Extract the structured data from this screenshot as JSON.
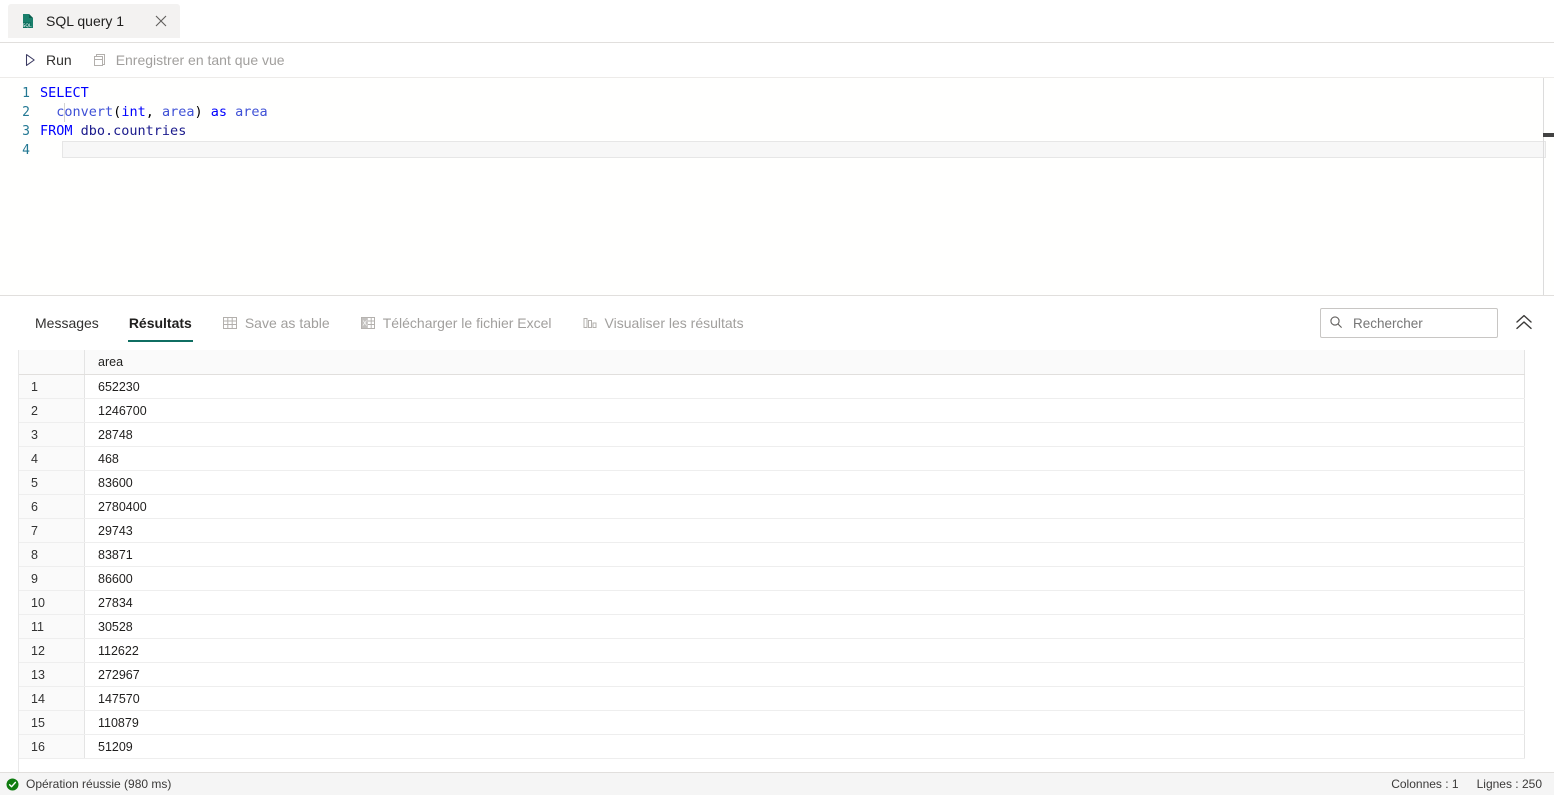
{
  "tab": {
    "icon": "sql-file-icon",
    "label": "SQL query 1",
    "close_icon": "close-icon"
  },
  "toolbar": {
    "run": {
      "label": "Run",
      "icon": "play-icon"
    },
    "save_as_view": {
      "label": "Enregistrer en tant que vue",
      "icon": "save-view-icon",
      "disabled": true
    }
  },
  "editor": {
    "lines": [
      {
        "number": "1",
        "tokens": [
          {
            "t": "SELECT",
            "c": "kw"
          }
        ]
      },
      {
        "number": "2",
        "tokens": [
          {
            "t": "  ",
            "c": "pl"
          },
          {
            "t": "convert",
            "c": "fn"
          },
          {
            "t": "(",
            "c": "pl"
          },
          {
            "t": "int",
            "c": "kw"
          },
          {
            "t": ", ",
            "c": "pl"
          },
          {
            "t": "area",
            "c": "fn"
          },
          {
            "t": ") ",
            "c": "pl"
          },
          {
            "t": "as",
            "c": "kw"
          },
          {
            "t": " ",
            "c": "pl"
          },
          {
            "t": "area",
            "c": "fn"
          }
        ]
      },
      {
        "number": "3",
        "tokens": [
          {
            "t": "FROM",
            "c": "kw"
          },
          {
            "t": " ",
            "c": "pl"
          },
          {
            "t": "dbo.countries",
            "c": "id"
          }
        ]
      },
      {
        "number": "4",
        "tokens": []
      }
    ]
  },
  "results": {
    "tabs": [
      {
        "label": "Messages",
        "icon": null,
        "selected": false,
        "disabled": false
      },
      {
        "label": "Résultats",
        "icon": null,
        "selected": true,
        "disabled": false
      },
      {
        "label": "Save as table",
        "icon": "table-icon",
        "selected": false,
        "disabled": true
      },
      {
        "label": "Télécharger le fichier Excel",
        "icon": "excel-icon",
        "selected": false,
        "disabled": true
      },
      {
        "label": "Visualiser les résultats",
        "icon": "bar-chart-icon",
        "selected": false,
        "disabled": true
      }
    ],
    "search": {
      "placeholder": "Rechercher",
      "value": "",
      "icon": "search-icon"
    },
    "collapse": {
      "icon": "double-chevron-up-icon"
    },
    "grid": {
      "columns": [
        "",
        "area"
      ],
      "rows": [
        {
          "n": "1",
          "area": "652230"
        },
        {
          "n": "2",
          "area": "1246700"
        },
        {
          "n": "3",
          "area": "28748"
        },
        {
          "n": "4",
          "area": "468"
        },
        {
          "n": "5",
          "area": "83600"
        },
        {
          "n": "6",
          "area": "2780400"
        },
        {
          "n": "7",
          "area": "29743"
        },
        {
          "n": "8",
          "area": "83871"
        },
        {
          "n": "9",
          "area": "86600"
        },
        {
          "n": "10",
          "area": "27834"
        },
        {
          "n": "11",
          "area": "30528"
        },
        {
          "n": "12",
          "area": "112622"
        },
        {
          "n": "13",
          "area": "272967"
        },
        {
          "n": "14",
          "area": "147570"
        },
        {
          "n": "15",
          "area": "110879"
        },
        {
          "n": "16",
          "area": "51209"
        }
      ]
    }
  },
  "status": {
    "icon": "success-check-icon",
    "message": "Opération réussie (980 ms)",
    "columns": "Colonnes : 1",
    "rows": "Lignes : 250"
  },
  "colors": {
    "accent_teal": "#0f6e62",
    "success_green": "#107c10",
    "keyword_blue": "#0000ff",
    "line_number": "#237893",
    "disabled_text": "#a19f9d"
  }
}
